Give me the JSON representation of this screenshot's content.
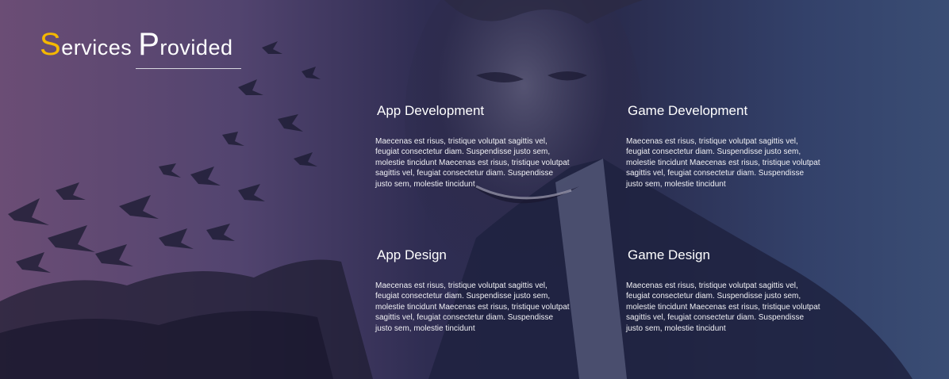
{
  "heading": {
    "first_initial": "S",
    "first_rest": "ervices",
    "second_initial": "P",
    "second_rest": "rovided",
    "accent_color": "#f5b800"
  },
  "background": {
    "image": "joker-face-with-bats",
    "gradient_start": "#6b4d75",
    "gradient_end": "#3a4d74"
  },
  "services": [
    {
      "title": "App Development",
      "description": "Maecenas est risus, tristique volutpat sagittis vel, feugiat consectetur diam. Suspendisse justo sem, molestie tincidunt  Maecenas est risus, tristique volutpat sagittis vel, feugiat consectetur diam. Suspendisse justo sem, molestie tincidunt"
    },
    {
      "title": "Game Development",
      "description": "Maecenas est risus, tristique volutpat sagittis vel, feugiat consectetur diam. Suspendisse justo sem, molestie tincidunt  Maecenas est risus, tristique volutpat sagittis vel, feugiat consectetur diam. Suspendisse justo sem, molestie tincidunt"
    },
    {
      "title": "App Design",
      "description": "Maecenas est risus, tristique volutpat sagittis vel, feugiat consectetur diam. Suspendisse justo sem, molestie tincidunt  Maecenas est risus, tristique volutpat sagittis vel, feugiat consectetur diam. Suspendisse justo sem, molestie tincidunt"
    },
    {
      "title": "Game Design",
      "description": "Maecenas est risus, tristique volutpat sagittis vel, feugiat consectetur diam. Suspendisse justo sem, molestie tincidunt  Maecenas est risus, tristique volutpat sagittis vel, feugiat consectetur diam. Suspendisse justo sem, molestie tincidunt"
    }
  ]
}
